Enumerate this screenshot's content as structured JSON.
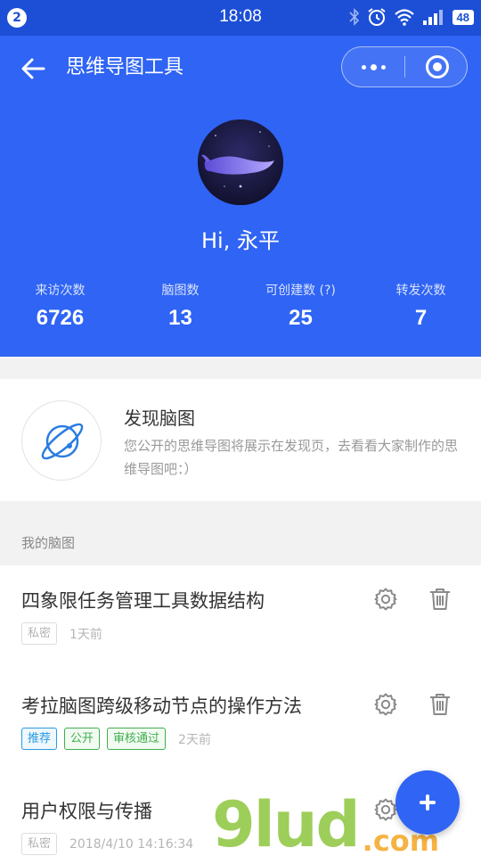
{
  "status_bar": {
    "notification_count": "2",
    "time": "18:08",
    "battery": "48",
    "icons": [
      "bluetooth-icon",
      "alarm-icon",
      "wifi-icon",
      "signal-icon"
    ]
  },
  "header": {
    "title": "思维导图工具",
    "greeting": "Hi, 永平",
    "accent_color": "#2f64f4"
  },
  "stats": [
    {
      "label": "来访次数",
      "value": "6726"
    },
    {
      "label": "脑图数",
      "value": "13"
    },
    {
      "label": "可创建数 (?)",
      "value": "25"
    },
    {
      "label": "转发次数",
      "value": "7"
    }
  ],
  "discover": {
    "title": "发现脑图",
    "description": "您公开的思维导图将展示在发现页，去看看大家制作的思维导图吧：）"
  },
  "my_maps": {
    "section_label": "我的脑图",
    "items": [
      {
        "title": "四象限任务管理工具数据结构",
        "tags": [
          {
            "text": "私密",
            "style": "gray"
          }
        ],
        "time": "1天前"
      },
      {
        "title": "考拉脑图跨级移动节点的操作方法",
        "tags": [
          {
            "text": "推荐",
            "style": "blue"
          },
          {
            "text": "公开",
            "style": "green"
          },
          {
            "text": "审核通过",
            "style": "green"
          }
        ],
        "time": "2天前"
      },
      {
        "title": "用户权限与传播",
        "tags": [
          {
            "text": "私密",
            "style": "gray"
          }
        ],
        "time": "2018/4/10 14:16:34"
      }
    ]
  },
  "watermark": {
    "main": "9lud",
    "sub": ".com"
  }
}
